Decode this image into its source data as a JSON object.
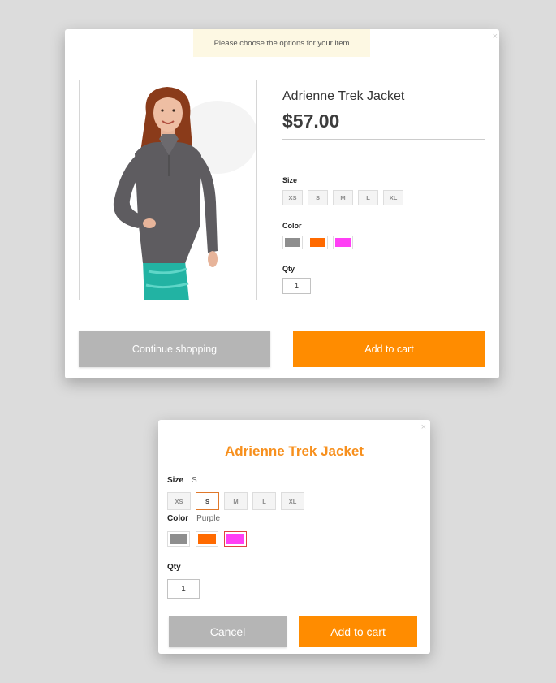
{
  "modal1": {
    "notice": "Please choose the options for your item",
    "close": "×",
    "product_name": "Adrienne Trek Jacket",
    "price": "$57.00",
    "size_label": "Size",
    "sizes": [
      "XS",
      "S",
      "M",
      "L",
      "XL"
    ],
    "color_label": "Color",
    "colors": [
      "#8e8e8e",
      "#ff6a00",
      "#ff3ff5"
    ],
    "qty_label": "Qty",
    "qty_value": "1",
    "continue_label": "Continue shopping",
    "add_to_cart_label": "Add to cart"
  },
  "modal2": {
    "close": "×",
    "title": "Adrienne Trek Jacket",
    "size_label": "Size",
    "size_selected": "S",
    "sizes": [
      "XS",
      "S",
      "M",
      "L",
      "XL"
    ],
    "color_label": "Color",
    "color_selected": "Purple",
    "colors": [
      "#8e8e8e",
      "#ff6a00",
      "#ff3ff5"
    ],
    "qty_label": "Qty",
    "qty_value": "1",
    "cancel_label": "Cancel",
    "add_to_cart_label": "Add to cart"
  },
  "colors": {
    "accent": "#ff8c00",
    "title_orange": "#f7901e",
    "grey_button": "#b5b5b5",
    "page_background": "#dcdcdc"
  }
}
